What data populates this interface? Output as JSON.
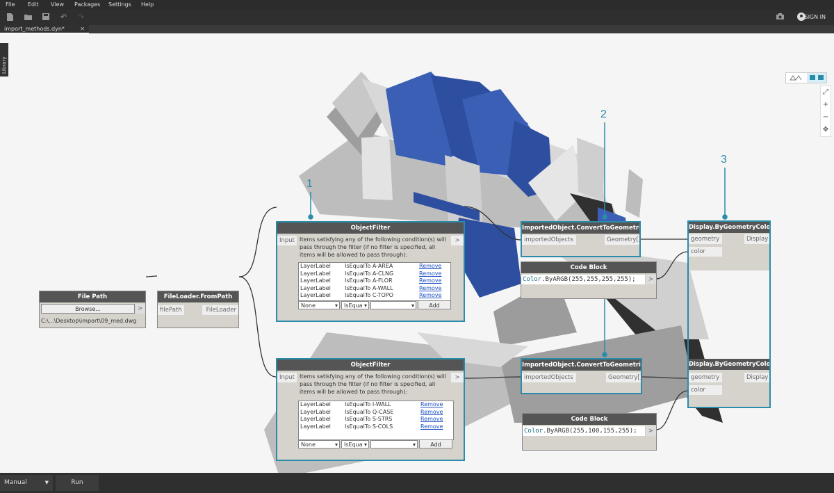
{
  "menu": [
    "File",
    "Edit",
    "View",
    "Packages",
    "Settings",
    "Help"
  ],
  "toolbar": {
    "signin": "SIGN IN"
  },
  "tab": {
    "name": "import_methods.dyn*",
    "close": "✕"
  },
  "library": "Library",
  "nodes": {
    "file_path": {
      "title": "File Path",
      "browse": "Browse...",
      "arrow": ">",
      "path": "C:\\...\\Desktop\\import\\09_med.dwg"
    },
    "file_loader": {
      "title": "FileLoader.FromPath",
      "in": "filePath",
      "out": "FileLoader"
    },
    "filter1": {
      "title": "ObjectFilter",
      "in": "Input",
      "out": ">",
      "desc": "Items satisfying any of the following condition(s) will pass through the filter (if no filter is specified, all items will be allowed to pass through):",
      "rows": [
        {
          "a": "LayerLabel",
          "b": "IsEqualTo A-AREA",
          "c": "Remove"
        },
        {
          "a": "LayerLabel",
          "b": "IsEqualTo A-CLNG",
          "c": "Remove"
        },
        {
          "a": "LayerLabel",
          "b": "IsEqualTo A-FLOR",
          "c": "Remove"
        },
        {
          "a": "LayerLabel",
          "b": "IsEqualTo A-WALL",
          "c": "Remove"
        },
        {
          "a": "LayerLabel",
          "b": "IsEqualTo C-TOPO",
          "c": "Remove"
        }
      ],
      "sel1": "None",
      "sel2": "IsEqua",
      "add": "Add"
    },
    "filter2": {
      "title": "ObjectFilter",
      "in": "Input",
      "out": ">",
      "desc": "Items satisfying any of the following condition(s) will pass through the filter (if no filter is specified, all items will be allowed to pass through):",
      "rows": [
        {
          "a": "LayerLabel",
          "b": "IsEqualTo I-WALL",
          "c": "Remove"
        },
        {
          "a": "LayerLabel",
          "b": "IsEqualTo Q-CASE",
          "c": "Remove"
        },
        {
          "a": "LayerLabel",
          "b": "IsEqualTo S-STRS",
          "c": "Remove"
        },
        {
          "a": "LayerLabel",
          "b": "IsEqualTo S-COLS",
          "c": "Remove"
        }
      ],
      "sel1": "None",
      "sel2": "IsEqua",
      "add": "Add"
    },
    "convert1": {
      "title": "ImportedObject.ConvertToGeometries",
      "in": "importedObjects",
      "out": "Geometry[]"
    },
    "convert2": {
      "title": "ImportedObject.ConvertToGeometries",
      "in": "importedObjects",
      "out": "Geometry[]"
    },
    "code1": {
      "title": "Code Block",
      "fn": "Color",
      "rest": ".ByARGB(255,255,255,255);",
      "out": ">"
    },
    "code2": {
      "title": "Code Block",
      "fn": "Color",
      "rest": ".ByARGB(255,100,155,255);",
      "out": ">"
    },
    "display1": {
      "title": "Display.ByGeometryColor",
      "in1": "geometry",
      "in2": "color",
      "out": "Display"
    },
    "display2": {
      "title": "Display.ByGeometryColor",
      "in1": "geometry",
      "in2": "color",
      "out": "Display"
    }
  },
  "markers": [
    "1",
    "2",
    "3"
  ],
  "bottom": {
    "mode": "Manual",
    "run": "Run"
  },
  "colors": {
    "accent": "#2a8ca8",
    "blue_geometry": "#3a5fb5"
  }
}
